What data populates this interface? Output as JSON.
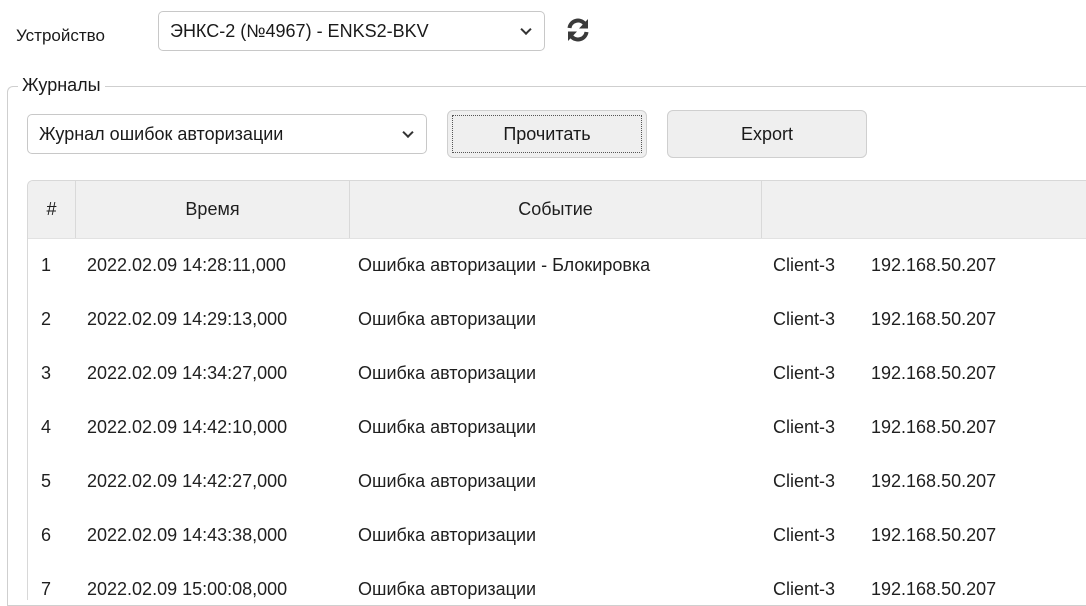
{
  "device": {
    "label": "Устройство",
    "selected": "ЭНКС-2 (№4967) - ENKS2-BKV"
  },
  "logs": {
    "legend": "Журналы",
    "selected_log": "Журнал ошибок авторизации",
    "read_button": "Прочитать",
    "export_button": "Export"
  },
  "table": {
    "columns": [
      "#",
      "Время",
      "Событие",
      ""
    ],
    "rows": [
      {
        "num": "1",
        "time": "2022.02.09 14:28:11,000",
        "event": "Ошибка авторизации - Блокировка",
        "client": "Client-3",
        "ip": "192.168.50.207"
      },
      {
        "num": "2",
        "time": "2022.02.09 14:29:13,000",
        "event": "Ошибка авторизации",
        "client": "Client-3",
        "ip": "192.168.50.207"
      },
      {
        "num": "3",
        "time": "2022.02.09 14:34:27,000",
        "event": "Ошибка авторизации",
        "client": "Client-3",
        "ip": "192.168.50.207"
      },
      {
        "num": "4",
        "time": "2022.02.09 14:42:10,000",
        "event": "Ошибка авторизации",
        "client": "Client-3",
        "ip": "192.168.50.207"
      },
      {
        "num": "5",
        "time": "2022.02.09 14:42:27,000",
        "event": "Ошибка авторизации",
        "client": "Client-3",
        "ip": "192.168.50.207"
      },
      {
        "num": "6",
        "time": "2022.02.09 14:43:38,000",
        "event": "Ошибка авторизации",
        "client": "Client-3",
        "ip": "192.168.50.207"
      },
      {
        "num": "7",
        "time": "2022.02.09 15:00:08,000",
        "event": "Ошибка авторизации",
        "client": "Client-3",
        "ip": "192.168.50.207"
      }
    ]
  }
}
